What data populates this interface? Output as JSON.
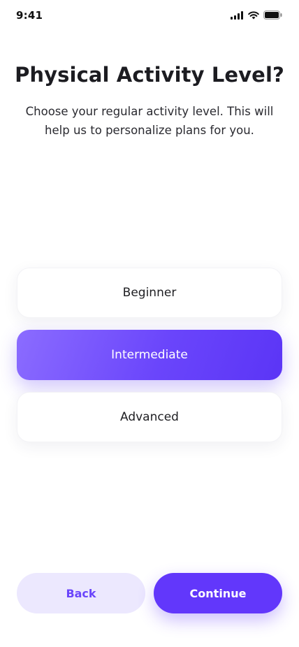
{
  "status_bar": {
    "time": "9:41",
    "icons": [
      "cellular-signal-icon",
      "wifi-icon",
      "battery-icon"
    ]
  },
  "header": {
    "title": "Physical Activity Level?",
    "subtitle": "Choose your regular activity level. This will help us to personalize plans for you."
  },
  "options": [
    {
      "label": "Beginner",
      "selected": false
    },
    {
      "label": "Intermediate",
      "selected": true
    },
    {
      "label": "Advanced",
      "selected": false
    }
  ],
  "footer": {
    "back_label": "Back",
    "continue_label": "Continue"
  },
  "colors": {
    "accent": "#6237fb",
    "accent_light": "#ece8fe",
    "text": "#1e1e22",
    "background": "#ffffff"
  }
}
